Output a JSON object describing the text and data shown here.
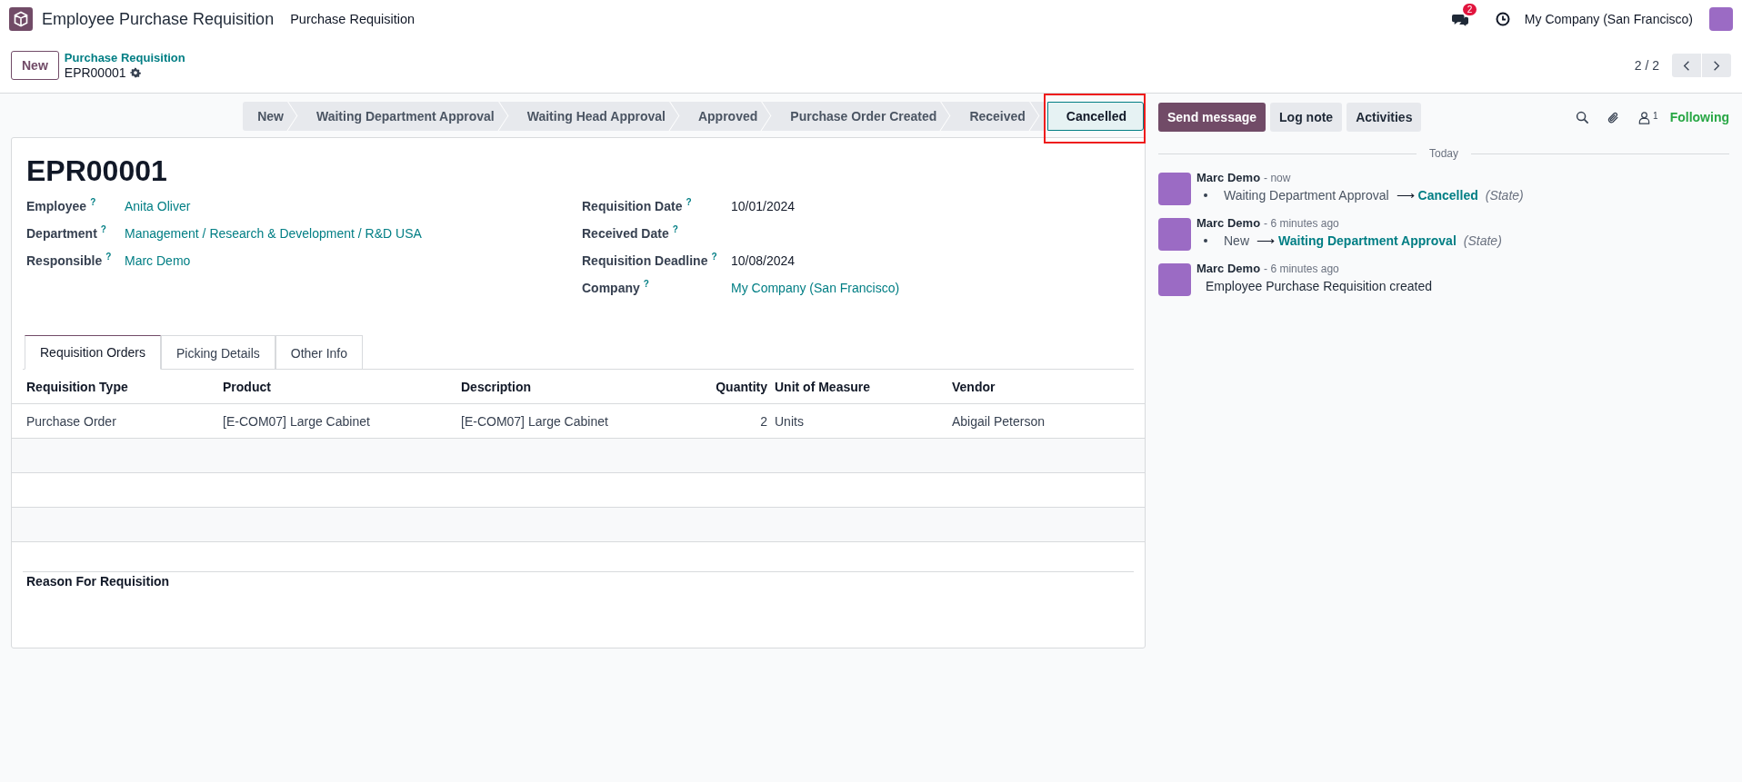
{
  "navbar": {
    "app_name": "Employee Purchase Requisition",
    "menu": [
      "Purchase Requisition"
    ],
    "messages_badge": "2",
    "company": "My Company (San Francisco)"
  },
  "control_panel": {
    "new_button": "New",
    "breadcrumb": "Purchase Requisition",
    "record": "EPR00001",
    "pager": "2 / 2"
  },
  "statusbar": [
    {
      "label": "New",
      "selected": false,
      "highlighted": false
    },
    {
      "label": "Waiting Department Approval",
      "selected": false,
      "highlighted": false
    },
    {
      "label": "Waiting Head Approval",
      "selected": false,
      "highlighted": false
    },
    {
      "label": "Approved",
      "selected": false,
      "highlighted": false
    },
    {
      "label": "Purchase Order Created",
      "selected": false,
      "highlighted": false
    },
    {
      "label": "Received",
      "selected": false,
      "highlighted": false
    },
    {
      "label": "Cancelled",
      "selected": true,
      "highlighted": true
    }
  ],
  "form": {
    "title": "EPR00001",
    "left_fields": [
      {
        "label": "Employee",
        "help": "?",
        "value": "Anita Oliver",
        "kind": "link"
      },
      {
        "label": "Department",
        "help": "?",
        "value": "Management / Research & Development / R&D USA",
        "kind": "link"
      },
      {
        "label": "Responsible",
        "help": "?",
        "value": "Marc Demo",
        "kind": "link"
      }
    ],
    "right_fields": [
      {
        "label": "Requisition Date",
        "help": "?",
        "value": "10/01/2024",
        "kind": "text"
      },
      {
        "label": "Received Date",
        "help": "?"
      },
      {
        "label": "Requisition Deadline",
        "help": "?",
        "value": "10/08/2024",
        "kind": "text"
      },
      {
        "label": "Company",
        "help": "?",
        "value": "My Company (San Francisco)",
        "kind": "link"
      }
    ],
    "tabs": [
      {
        "label": "Requisition Orders",
        "selected": true
      },
      {
        "label": "Picking Details",
        "selected": false
      },
      {
        "label": "Other Info",
        "selected": false
      }
    ],
    "table": {
      "columns": [
        {
          "label": "Requisition Type",
          "numeric": false
        },
        {
          "label": "Product",
          "numeric": false
        },
        {
          "label": "Description",
          "numeric": false
        },
        {
          "label": "Quantity",
          "numeric": true
        },
        {
          "label": "Unit of Measure",
          "numeric": false
        },
        {
          "label": "Vendor",
          "numeric": false
        }
      ],
      "rows": [
        [
          "Purchase Order",
          "[E-COM07] Large Cabinet",
          "[E-COM07] Large Cabinet",
          "2",
          "Units",
          "Abigail Peterson"
        ]
      ]
    },
    "reason_label": "Reason For Requisition"
  },
  "chatter": {
    "buttons": [
      {
        "label": "Send message",
        "primary": true
      },
      {
        "label": "Log note",
        "primary": false
      },
      {
        "label": "Activities",
        "primary": false
      }
    ],
    "followers_count": "1",
    "following": "Following",
    "date_separator": "Today",
    "messages": [
      {
        "author": "Marc Demo",
        "time": "- now",
        "kind": "tracking",
        "old": "Waiting Department Approval",
        "arrow": "⟶",
        "new": "Cancelled",
        "field": "(State)"
      },
      {
        "author": "Marc Demo",
        "time": "- 6 minutes ago",
        "kind": "tracking",
        "old": "New",
        "arrow": "⟶",
        "new": "Waiting Department Approval",
        "field": "(State)"
      },
      {
        "author": "Marc Demo",
        "time": "- 6 minutes ago",
        "kind": "note",
        "body": "Employee Purchase Requisition created"
      }
    ]
  }
}
